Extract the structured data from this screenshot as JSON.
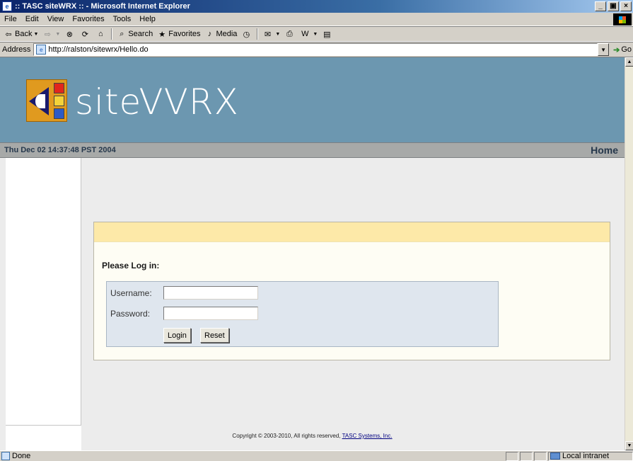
{
  "window": {
    "title": ":: TASC siteWRX :: - Microsoft Internet Explorer",
    "minimize": "_",
    "maximize": "▣",
    "close": "×"
  },
  "menu": {
    "items": [
      {
        "label": "File"
      },
      {
        "label": "Edit"
      },
      {
        "label": "View"
      },
      {
        "label": "Favorites"
      },
      {
        "label": "Tools"
      },
      {
        "label": "Help"
      }
    ]
  },
  "toolbar": {
    "back_label": "Back",
    "search_label": "Search",
    "favorites_label": "Favorites",
    "media_label": "Media"
  },
  "address": {
    "label": "Address",
    "url": "http://ralston/sitewrx/Hello.do",
    "go_label": "Go"
  },
  "site": {
    "brand": "siteVVRX",
    "date": "Thu Dec 02 14:37:48 PST 2004",
    "home_link": "Home"
  },
  "login": {
    "heading": "Please Log in:",
    "username_label": "Username:",
    "password_label": "Password:",
    "username_value": "",
    "password_value": "",
    "login_button": "Login",
    "reset_button": "Reset"
  },
  "footer": {
    "copyright": "Copyright © 2003-2010, All rights reserved,",
    "company_link": "TASC Systems, Inc."
  },
  "status": {
    "text": "Done",
    "zone": "Local intranet"
  }
}
